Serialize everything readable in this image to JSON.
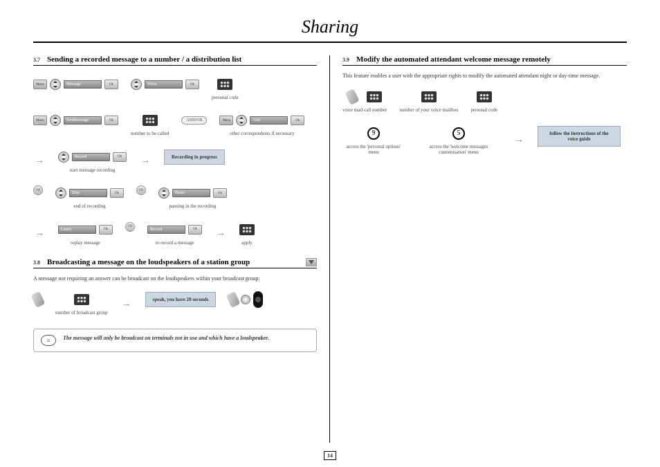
{
  "page": {
    "title": "Sharing",
    "number": "14"
  },
  "s37": {
    "num": "3.7",
    "title": "Sending a recorded message to a number / a distribution list",
    "labels": {
      "menu": "Menu",
      "message": "Message",
      "ok": "Ok",
      "voice": "Voice",
      "personal_code": "personal code",
      "sendmessage": "Sendmessage",
      "andor": "AND/OR",
      "add": "Add",
      "number_to_called": "number to be called",
      "other_correspondents": "other correspondents if necessary",
      "record": "Record",
      "start_recording": "start message recording",
      "recording_progress": "Recording in progress",
      "stop": "Stop",
      "pause": "Pause",
      "end_recording": "end of recording",
      "pausing": "pausing in the recording",
      "listen": "Listen",
      "replay": "replay message",
      "re_record": "re-record a message",
      "apply": "apply"
    }
  },
  "s38": {
    "num": "3.8",
    "title": "Broadcasting a message on the loudspeakers of a station group",
    "intro": "A message not requiring an answer can be broadcast on the loudspeakers within your broadcast group:",
    "labels": {
      "num_broadcast": "number of broadcast group",
      "speak": "speak, you have 20 seconds",
      "note": "The message will only be broadcast on terminals not in use and which have a loudspeaker."
    }
  },
  "s39": {
    "num": "3.9",
    "title": "Modify the automated attendant welcome message remotely",
    "intro": "This feature enables a user with the appropriate rights to modify the automated attendant night or day-time message.",
    "labels": {
      "voicemail_call": "voice mail call number",
      "num_mailbox": "number of your voice mailbox",
      "personal_code": "personal code",
      "nine": "9",
      "five": "5",
      "access_personal": "access the 'personal options' menu",
      "access_welcome": "access the 'welcome messages customisation' menu",
      "follow": "follow the instructions of the voice guide"
    }
  }
}
